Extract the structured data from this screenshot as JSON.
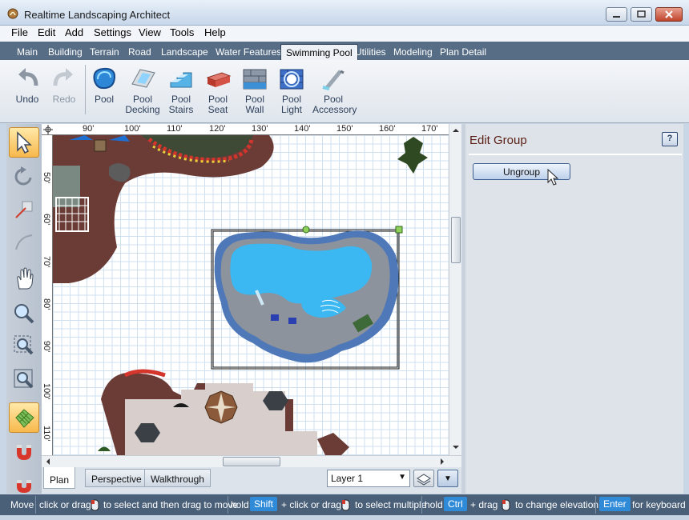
{
  "window": {
    "title": "Realtime Landscaping Architect"
  },
  "menu": [
    "File",
    "Edit",
    "Add",
    "Settings",
    "View",
    "Tools",
    "Help"
  ],
  "tabs": [
    "Main",
    "Building",
    "Terrain",
    "Road",
    "Landscape",
    "Water Features",
    "Swimming Pool",
    "Utilities",
    "Modeling",
    "Plan Detail"
  ],
  "active_tab": "Swimming Pool",
  "toolbar": {
    "undo": "Undo",
    "redo": "Redo",
    "tools": [
      {
        "line1": "Pool",
        "line2": "",
        "icon": "pool-icon"
      },
      {
        "line1": "Pool",
        "line2": "Decking",
        "icon": "pool-decking-icon"
      },
      {
        "line1": "Pool",
        "line2": "Stairs",
        "icon": "pool-stairs-icon"
      },
      {
        "line1": "Pool",
        "line2": "Seat",
        "icon": "pool-seat-icon"
      },
      {
        "line1": "Pool",
        "line2": "Wall",
        "icon": "pool-wall-icon"
      },
      {
        "line1": "Pool",
        "line2": "Light",
        "icon": "pool-light-icon"
      },
      {
        "line1": "Pool",
        "line2": "Accessory",
        "icon": "pool-accessory-icon"
      }
    ]
  },
  "ruler": {
    "top": [
      "90'",
      "100'",
      "110'",
      "120'",
      "130'",
      "140'",
      "150'",
      "160'",
      "170'"
    ],
    "left": [
      "50'",
      "60'",
      "70'",
      "80'",
      "90'",
      "100'",
      "110'"
    ]
  },
  "view_tabs": [
    "Plan",
    "Perspective",
    "Walkthrough"
  ],
  "active_view": "Plan",
  "layer": {
    "value": "Layer 1"
  },
  "panel": {
    "title": "Edit Group",
    "help": "?",
    "ungroup": "Ungroup"
  },
  "status": {
    "mode": "Move",
    "t1": "click or drag",
    "t2": "to select and then drag to move",
    "hold1": "hold",
    "key_shift": "Shift",
    "t3": "+ click or drag",
    "t4": "to select multiple",
    "hold2": "hold",
    "key_ctrl": "Ctrl",
    "t5": "+ drag",
    "t6": "to change elevation",
    "key_enter": "Enter",
    "t7": "for keyboard"
  },
  "colors": {
    "tabbar": "#566d85",
    "status": "#4a5f78",
    "key": "#2f8ad8",
    "water": "#3bb7f2",
    "pool_edge": "#4f78b8"
  }
}
